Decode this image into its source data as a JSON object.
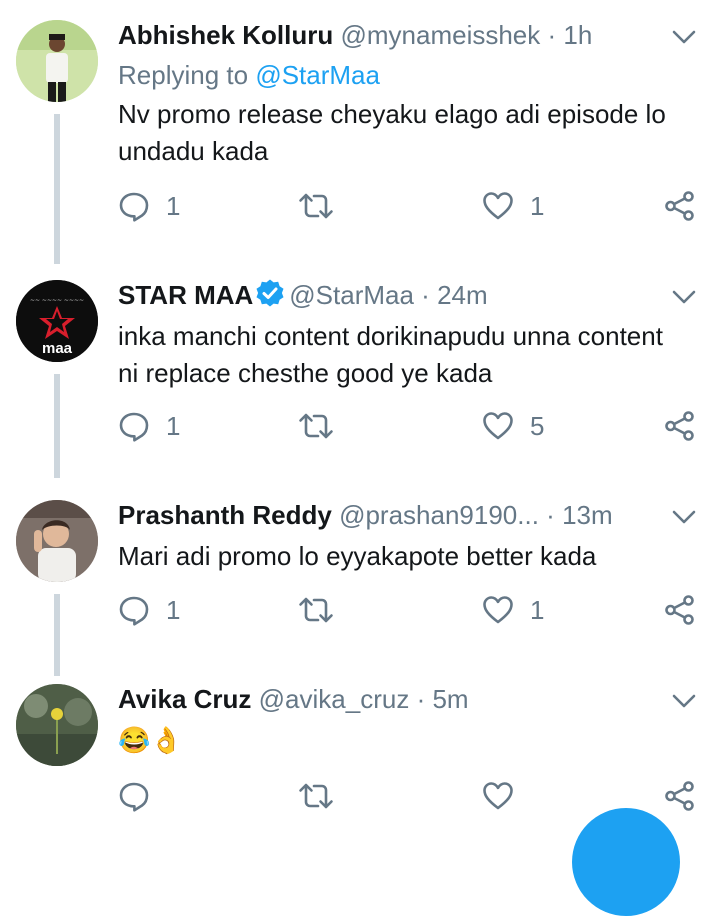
{
  "tweets": [
    {
      "name": "Abhishek Kolluru",
      "handle": "@mynameisshek",
      "time": "1h",
      "replying_label": "Replying to",
      "replying_to": "@StarMaa",
      "text": "Nv promo release cheyaku elago adi episode lo undadu kada",
      "replies": "1",
      "retweets": "",
      "likes": "1"
    },
    {
      "name": "STAR MAA",
      "verified": true,
      "handle": "@StarMaa",
      "time": "24m",
      "text": "inka manchi content dorikinapudu unna content ni replace chesthe good ye kada",
      "replies": "1",
      "retweets": "",
      "likes": "5",
      "avatar_text": "maa"
    },
    {
      "name": "Prashanth Reddy",
      "handle": "@prashan9190...",
      "time": "13m",
      "text": "Mari adi promo lo eyyakapote  better kada",
      "replies": "1",
      "retweets": "",
      "likes": "1"
    },
    {
      "name": "Avika Cruz",
      "handle": "@avika_cruz",
      "time": "5m",
      "text": "😂👌",
      "replies": "",
      "retweets": "",
      "likes": ""
    }
  ],
  "separator": "·",
  "colors": {
    "accent": "#1da1f2",
    "secondary_text": "#657786",
    "thread_line": "#cdd6dd"
  },
  "icons": {
    "reply": "reply-icon",
    "retweet": "retweet-icon",
    "like": "heart-icon",
    "share": "share-icon",
    "more": "chevron-down-icon",
    "verified": "verified-badge-icon"
  }
}
